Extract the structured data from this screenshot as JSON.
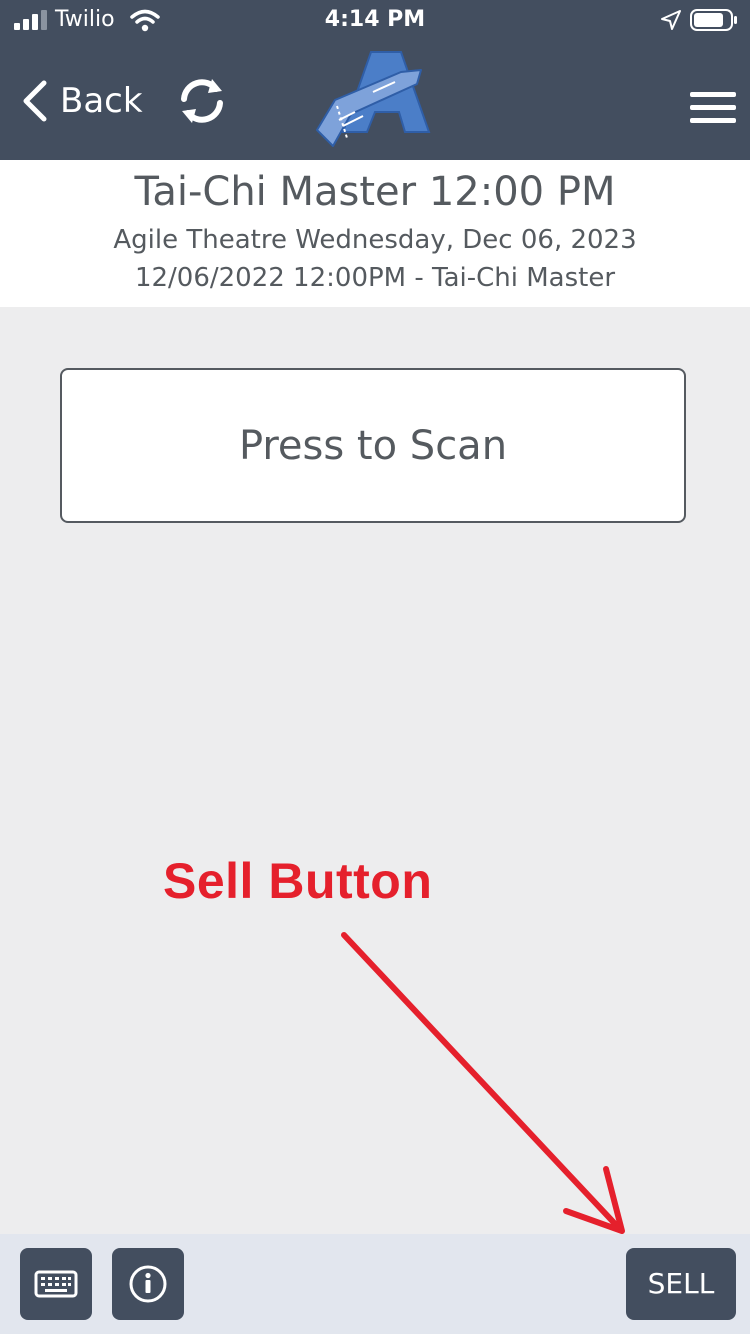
{
  "status_bar": {
    "carrier": "Twilio",
    "time": "4:14 PM"
  },
  "nav": {
    "back_label": "Back"
  },
  "event": {
    "title": "Tai-Chi Master 12:00 PM",
    "venue_date": "Agile Theatre Wednesday, Dec 06, 2023",
    "performance": "12/06/2022 12:00PM - Tai-Chi Master"
  },
  "scan": {
    "label": "Press to Scan"
  },
  "annotation": {
    "text": "Sell Button"
  },
  "bottom_bar": {
    "sell_label": "SELL"
  },
  "colors": {
    "nav_background": "#434e5f",
    "content_background": "#ededee",
    "annotation_red": "#e5202c",
    "text_gray": "#555a5f",
    "bottom_bar": "#e2e6ee"
  },
  "icons": {
    "signal": "cellular-signal-icon",
    "wifi": "wifi-icon",
    "location": "location-arrow-icon",
    "battery": "battery-icon",
    "back": "chevron-left-icon",
    "refresh": "refresh-icon",
    "menu": "hamburger-menu-icon",
    "keyboard": "keyboard-icon",
    "info": "info-icon"
  }
}
